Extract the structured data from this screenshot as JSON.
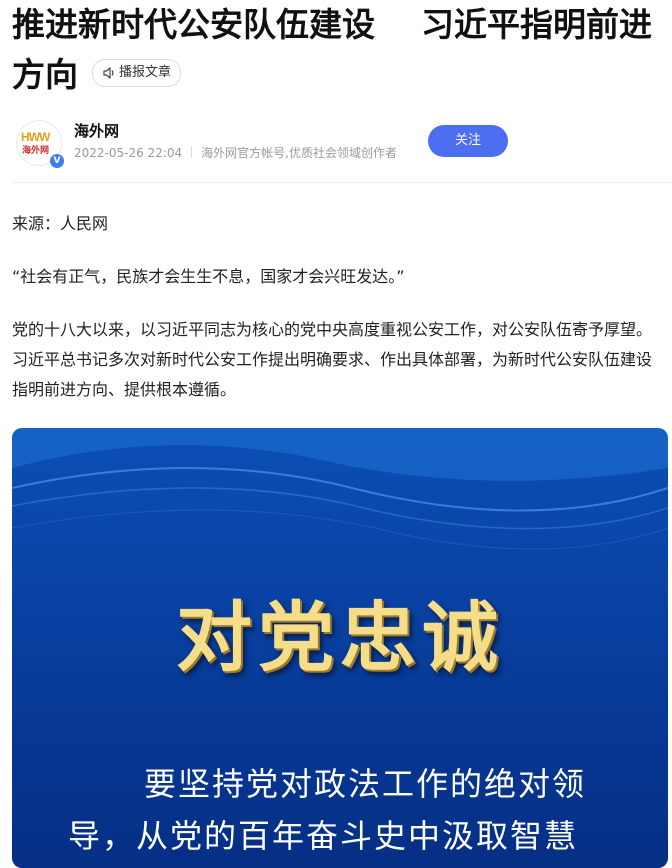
{
  "article": {
    "title_part1": "推进新时代公安队伍建设",
    "title_part2": "习近平指明前进方向",
    "listen_label": "播报文章"
  },
  "author": {
    "logo_text": "HWW",
    "logo_cn": "海外网",
    "verified_badge": "V",
    "name": "海外网",
    "date": "2022-05-26 22:04",
    "description": "海外网官方帐号,优质社会领域创作者",
    "follow_label": "关注"
  },
  "content": {
    "source": "来源：人民网",
    "quote": "“社会有正气，民族才会生生不息，国家才会兴旺发达。”",
    "body": "党的十八大以来，以习近平同志为核心的党中央高度重视公安工作，对公安队伍寄予厚望。习近平总书记多次对新时代公安工作提出明确要求、作出具体部署，为新时代公安队伍建设指明前进方向、提供根本遵循。"
  },
  "banner": {
    "headline": "对党忠诚",
    "quote": "要坚持党对政法工作的绝对领导，从党的百年奋斗史中汲取智慧"
  },
  "colors": {
    "accent": "#4e6ef2",
    "banner_blue": "#0a45a8",
    "headline_gold": "#f6dd8a"
  },
  "icons": {
    "listen": "speaker-icon",
    "verified": "verified-badge-icon"
  }
}
